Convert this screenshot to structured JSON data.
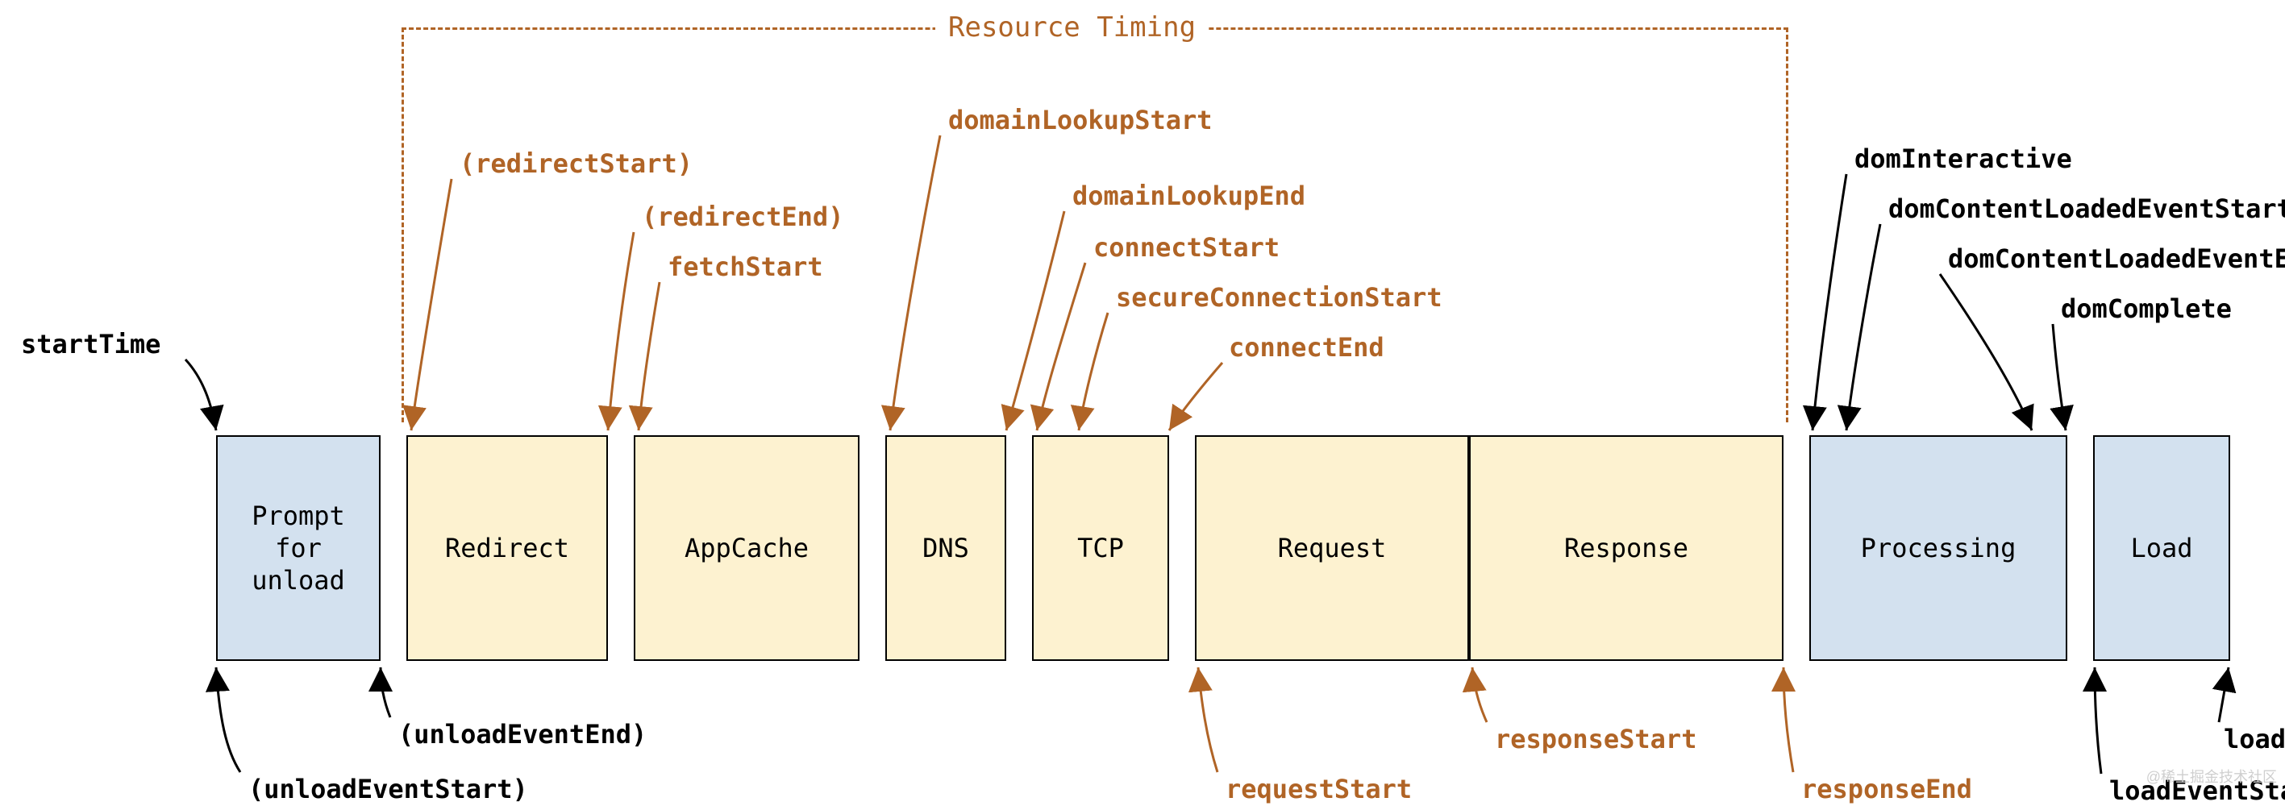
{
  "title": "Resource Timing",
  "watermark": "@稀土掘金技术社区",
  "boxes": {
    "prompt": {
      "label": "Prompt\nfor\nunload"
    },
    "redirect": {
      "label": "Redirect"
    },
    "appcache": {
      "label": "AppCache"
    },
    "dns": {
      "label": "DNS"
    },
    "tcp": {
      "label": "TCP"
    },
    "request": {
      "label": "Request"
    },
    "response": {
      "label": "Response"
    },
    "processing": {
      "label": "Processing"
    },
    "load": {
      "label": "Load"
    }
  },
  "labels": {
    "startTime": "startTime",
    "unloadEventStart": "(unloadEventStart)",
    "unloadEventEnd": "(unloadEventEnd)",
    "redirectStart": "(redirectStart)",
    "redirectEnd": "(redirectEnd)",
    "fetchStart": "fetchStart",
    "domainLookupStart": "domainLookupStart",
    "domainLookupEnd": "domainLookupEnd",
    "connectStart": "connectStart",
    "secureConnectionStart": "secureConnectionStart",
    "connectEnd": "connectEnd",
    "requestStart": "requestStart",
    "responseStart": "responseStart",
    "responseEnd": "responseEnd",
    "domInteractive": "domInteractive",
    "domContentLoadedEventStart": "domContentLoadedEventStart",
    "domContentLoadedEventEnd": "domContentLoadedEventEnd",
    "domComplete": "domComplete",
    "loadEventStart": "loadEventStart",
    "loadEventEnd": "loadEventEnd"
  }
}
